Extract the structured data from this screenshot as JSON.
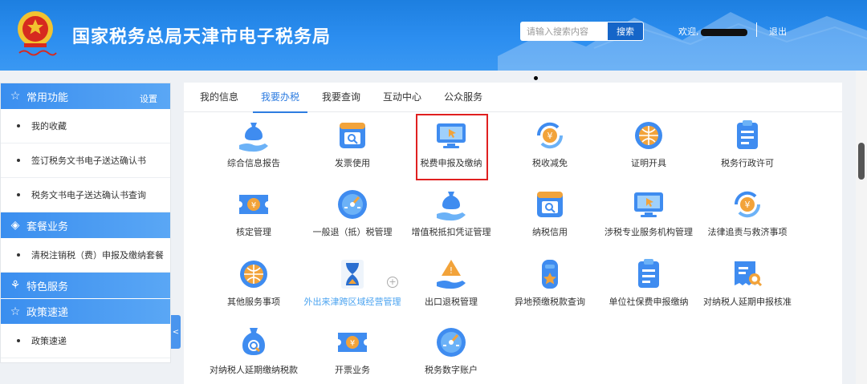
{
  "header": {
    "title": "国家税务总局天津市电子税务局",
    "search_placeholder": "请输入搜索内容",
    "search_label": "搜索",
    "welcome_label": "欢迎,",
    "logout_label": "退出",
    "brand_color": "#2c8ef0"
  },
  "sidebar": {
    "sections": [
      {
        "title": "常用功能",
        "icon": "star-icon",
        "action": "设置",
        "items": [
          "我的收藏",
          "签订税务文书电子送达确认书",
          "税务文书电子送达确认书查询"
        ]
      },
      {
        "title": "套餐业务",
        "icon": "layers-icon",
        "items": [
          "清税注销税（费）申报及缴纳套餐"
        ]
      },
      {
        "title": "特色服务",
        "icon": "grid-icon",
        "items": []
      },
      {
        "title": "政策速递",
        "icon": "star-icon",
        "items": [
          "政策速递"
        ]
      }
    ],
    "collapse_label": "<"
  },
  "tabs": [
    "我的信息",
    "我要办税",
    "我要查询",
    "互动中心",
    "公众服务"
  ],
  "tiles": [
    {
      "label": "综合信息报告",
      "icon": "money-bag-hand-icon"
    },
    {
      "label": "发票使用",
      "icon": "invoice-search-icon"
    },
    {
      "label": "税费申报及缴纳",
      "icon": "monitor-cursor-icon"
    },
    {
      "label": "税收减免",
      "icon": "yuan-cycle-icon"
    },
    {
      "label": "证明开具",
      "icon": "globe-icon"
    },
    {
      "label": "税务行政许可",
      "icon": "clipboard-icon"
    },
    {
      "label": "核定管理",
      "icon": "yuan-ticket-icon"
    },
    {
      "label": "一般退（抵）税管理",
      "icon": "gauge-icon"
    },
    {
      "label": "增值税抵扣凭证管理",
      "icon": "money-bag-hand-icon"
    },
    {
      "label": "纳税信用",
      "icon": "invoice-search-icon"
    },
    {
      "label": "涉税专业服务机构管理",
      "icon": "monitor-cursor-icon"
    },
    {
      "label": "法律追责与救济事项",
      "icon": "yuan-cycle-icon"
    },
    {
      "label": "其他服务事项",
      "icon": "globe-icon"
    },
    {
      "label": "外出来津跨区域经营管理",
      "icon": "hourglass-icon"
    },
    {
      "label": "出口退税管理",
      "icon": "warning-hand-icon"
    },
    {
      "label": "异地预缴税款查询",
      "icon": "phone-star-icon"
    },
    {
      "label": "单位社保费申报缴纳",
      "icon": "clipboard-icon"
    },
    {
      "label": "对纳税人延期申报核准",
      "icon": "receipt-search-icon"
    },
    {
      "label": "对纳税人延期缴纳税款",
      "icon": "bag-search-icon"
    },
    {
      "label": "开票业务",
      "icon": "yuan-ticket-icon"
    },
    {
      "label": "税务数字账户",
      "icon": "gauge-icon"
    }
  ]
}
